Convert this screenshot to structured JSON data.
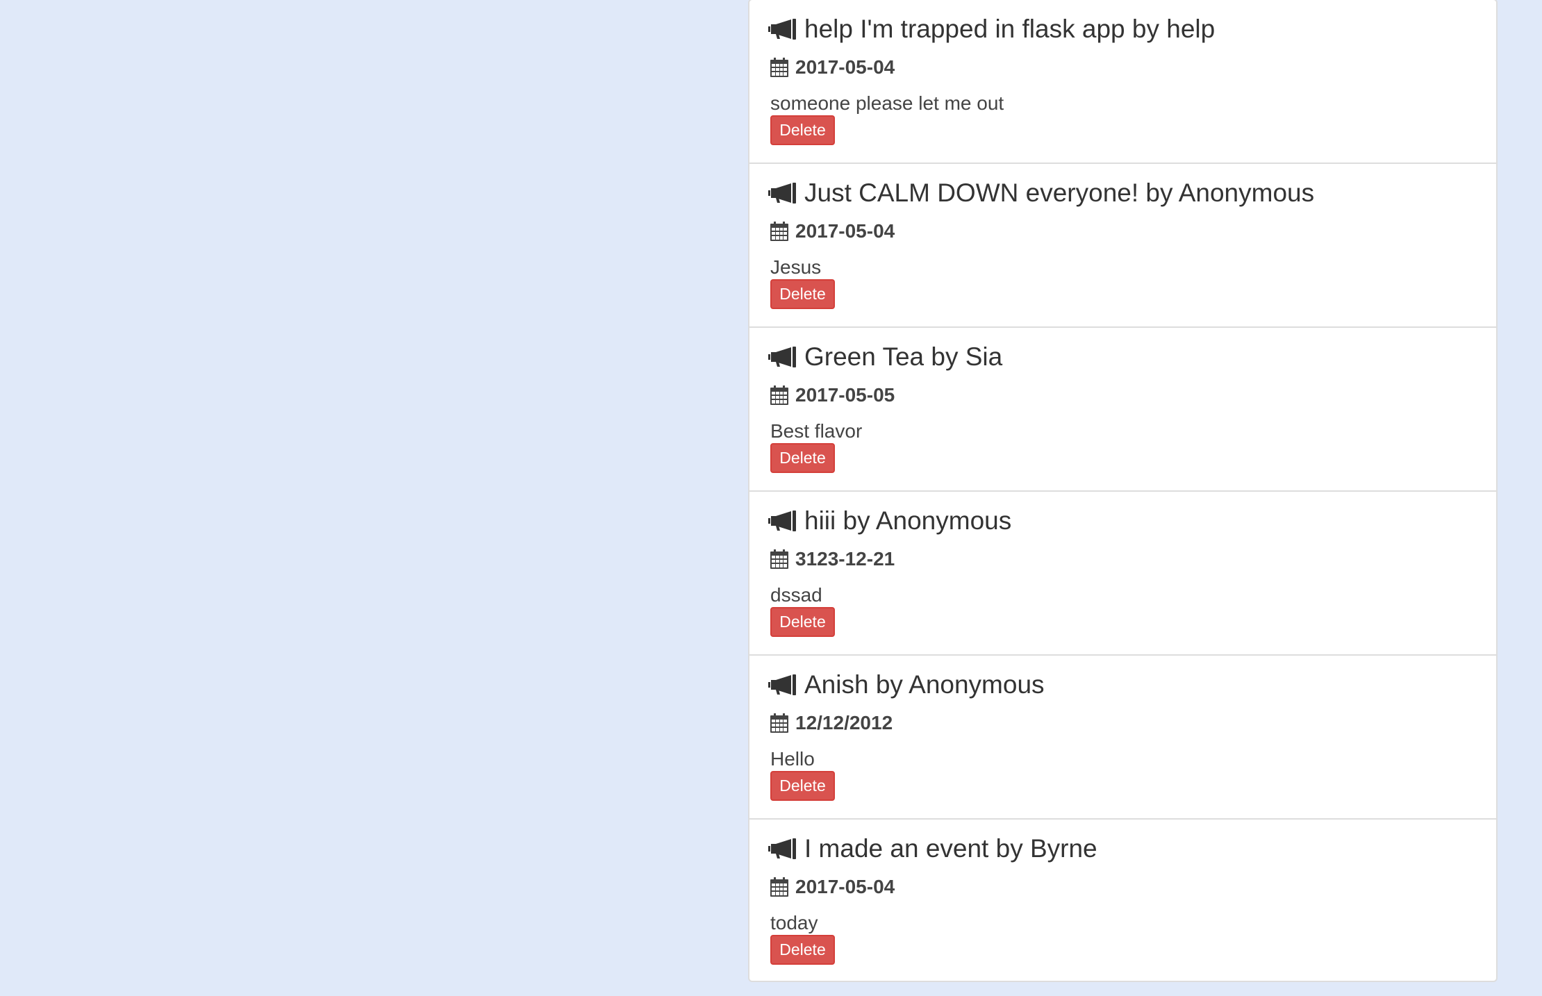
{
  "events": [
    {
      "title": "help I'm trapped in flask app by help",
      "date": "2017-05-04",
      "description": "someone please let me out",
      "delete_label": "Delete"
    },
    {
      "title": "Just CALM DOWN everyone! by Anonymous",
      "date": "2017-05-04",
      "description": "Jesus",
      "delete_label": "Delete"
    },
    {
      "title": "Green Tea by Sia",
      "date": "2017-05-05",
      "description": "Best flavor",
      "delete_label": "Delete"
    },
    {
      "title": "hiii by Anonymous",
      "date": "3123-12-21",
      "description": "dssad",
      "delete_label": "Delete"
    },
    {
      "title": "Anish by Anonymous",
      "date": "12/12/2012",
      "description": "Hello",
      "delete_label": "Delete"
    },
    {
      "title": "I made an event by Byrne",
      "date": "2017-05-04",
      "description": "today",
      "delete_label": "Delete"
    }
  ],
  "icons": {
    "title_icon": "bullhorn-icon",
    "date_icon": "calendar-icon"
  },
  "colors": {
    "background": "#e0e9f9",
    "card": "#ffffff",
    "divider": "#dddddd",
    "delete_button": "#d9534f",
    "text": "#333333"
  }
}
